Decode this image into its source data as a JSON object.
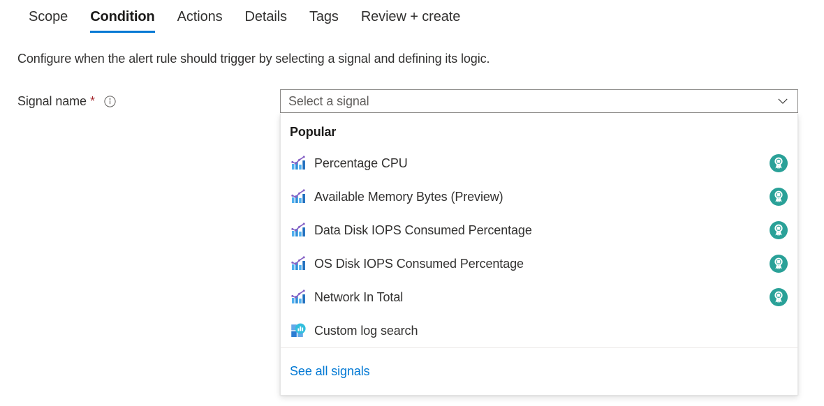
{
  "tabs": [
    {
      "label": "Scope",
      "active": false
    },
    {
      "label": "Condition",
      "active": true
    },
    {
      "label": "Actions",
      "active": false
    },
    {
      "label": "Details",
      "active": false
    },
    {
      "label": "Tags",
      "active": false
    },
    {
      "label": "Review + create",
      "active": false
    }
  ],
  "description": "Configure when the alert rule should trigger by selecting a signal and defining its logic.",
  "signal_field": {
    "label": "Signal name",
    "required_marker": "*",
    "info_icon": "info-icon",
    "placeholder": "Select a signal",
    "value": "",
    "chevron_icon": "chevron-down-icon"
  },
  "dropdown": {
    "group_header": "Popular",
    "options": [
      {
        "label": "Percentage CPU",
        "icon": "metric-chart-icon",
        "badge": "recommended-award-icon"
      },
      {
        "label": "Available Memory Bytes (Preview)",
        "icon": "metric-chart-icon",
        "badge": "recommended-award-icon"
      },
      {
        "label": "Data Disk IOPS Consumed Percentage",
        "icon": "metric-chart-icon",
        "badge": "recommended-award-icon"
      },
      {
        "label": "OS Disk IOPS Consumed Percentage",
        "icon": "metric-chart-icon",
        "badge": "recommended-award-icon"
      },
      {
        "label": "Network In Total",
        "icon": "metric-chart-icon",
        "badge": "recommended-award-icon"
      },
      {
        "label": "Custom log search",
        "icon": "log-search-icon",
        "badge": ""
      }
    ],
    "footer_link": "See all signals"
  },
  "colors": {
    "accent": "#0078d4",
    "required": "#a4262c",
    "badge_teal": "#2aa198",
    "text": "#323130",
    "placeholder": "#605e5c",
    "border": "#8a8886"
  }
}
